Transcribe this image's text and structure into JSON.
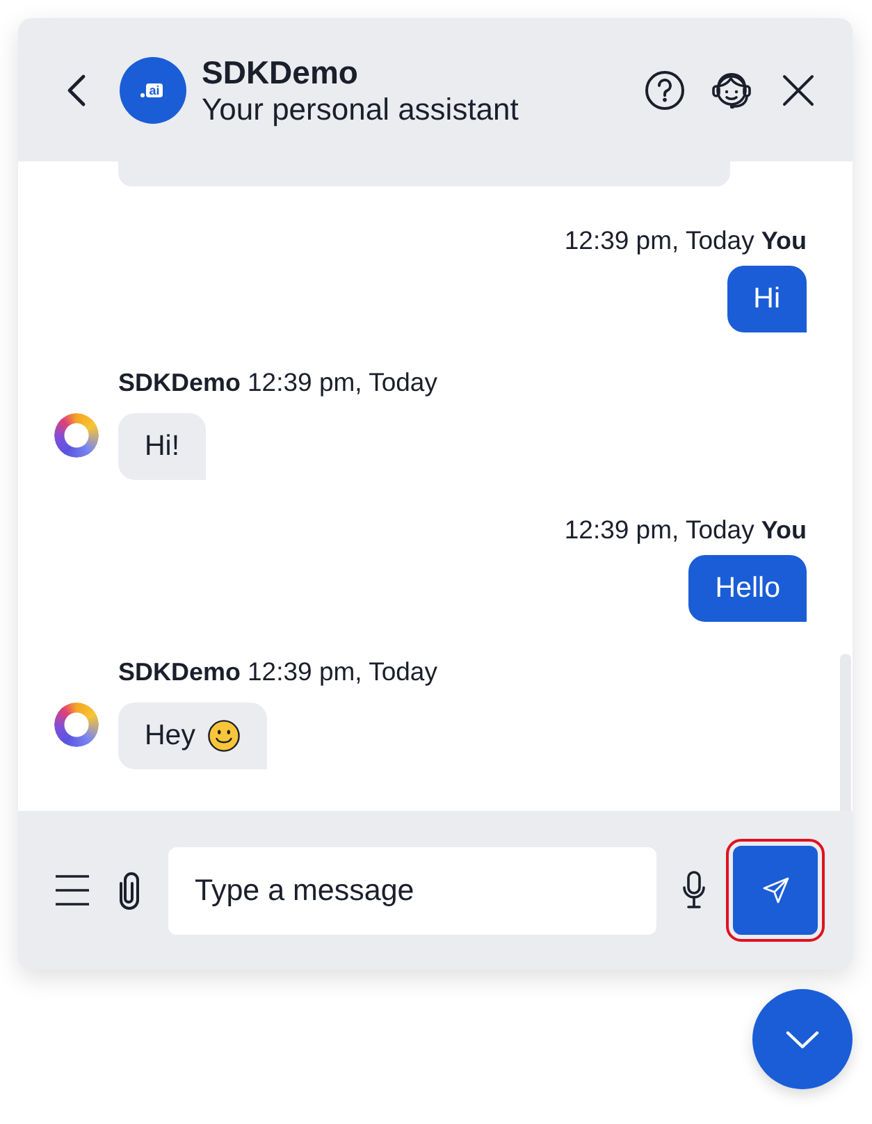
{
  "header": {
    "title": "SDKDemo",
    "subtitle": "Your personal assistant",
    "logo_text": "ai"
  },
  "messages": [
    {
      "kind": "clipped"
    },
    {
      "kind": "user",
      "time": "12:39 pm, Today",
      "sender": "You",
      "text": "Hi",
      "emoji": false
    },
    {
      "kind": "bot",
      "sender": "SDKDemo",
      "time": "12:39 pm, Today",
      "text": "Hi!",
      "emoji": false
    },
    {
      "kind": "user",
      "time": "12:39 pm, Today",
      "sender": "You",
      "text": "Hello",
      "emoji": false
    },
    {
      "kind": "bot",
      "sender": "SDKDemo",
      "time": "12:39 pm, Today",
      "text": "Hey",
      "emoji": true
    }
  ],
  "composer": {
    "placeholder": "Type a message",
    "send_focused": true
  }
}
